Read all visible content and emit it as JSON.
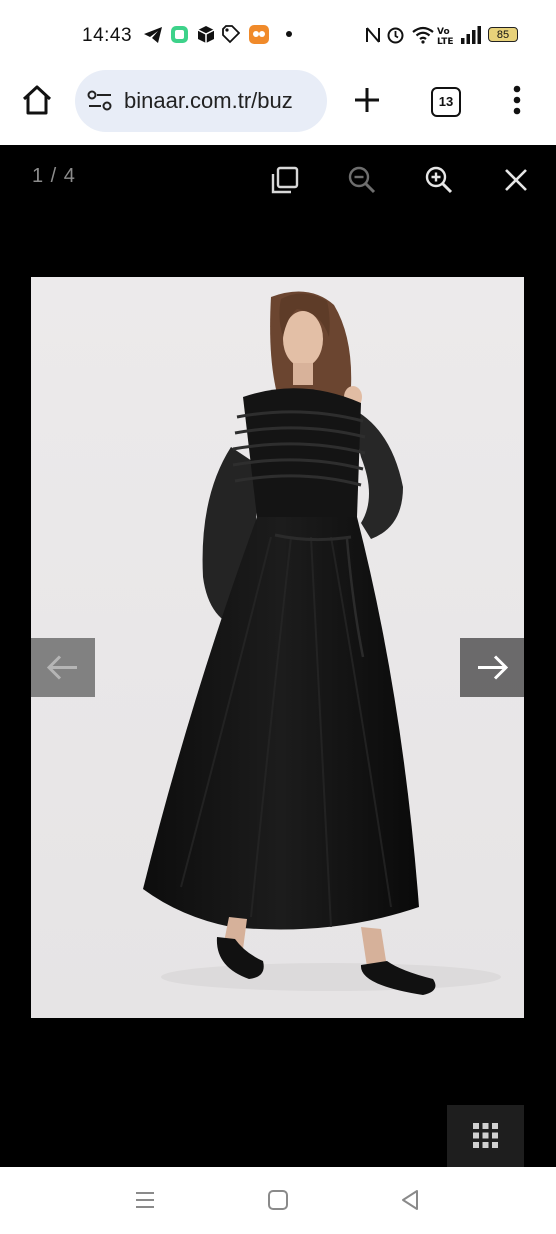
{
  "status_bar": {
    "time": "14:43",
    "battery": "85",
    "icons": [
      "telegram-icon",
      "app-icon",
      "box-icon",
      "tag-icon",
      "game-icon",
      "dot-icon",
      "nfc-icon",
      "alarm-icon",
      "wifi-icon",
      "volte-icon",
      "signal-icon",
      "battery-icon"
    ]
  },
  "browser": {
    "url": "binaar.com.tr/buz",
    "tab_count": "13",
    "icons": [
      "home-icon",
      "site-settings-icon",
      "new-tab-icon",
      "tabs-icon",
      "more-icon"
    ]
  },
  "viewer": {
    "counter": "1 / 4",
    "background": "#000000",
    "photo_background": "#eceaeb",
    "controls": [
      "fullscreen-icon",
      "zoom-out-icon",
      "zoom-in-icon",
      "close-icon"
    ],
    "image_subject": "Woman wearing a long black chiffon dress with smocked yoke and balloon sleeves"
  },
  "system_nav": [
    "recent-apps-icon",
    "home-button-icon",
    "back-icon"
  ]
}
